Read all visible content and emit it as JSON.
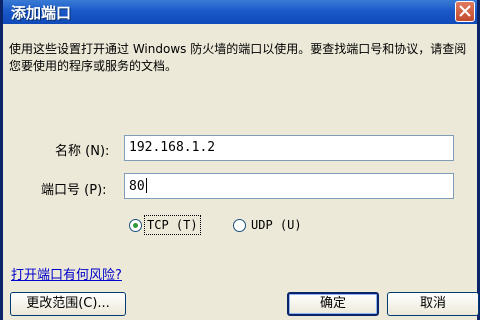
{
  "window": {
    "title": "添加端口"
  },
  "description": "使用这些设置打开通过 Windows 防火墙的端口以使用。要查找端口号和协议，请查阅您要使用的程序或服务的文档。",
  "name_field": {
    "label": "名称",
    "hotkey": "(N)",
    "suffix": ":",
    "value": "192.168.1.2"
  },
  "port_field": {
    "label": "端口号",
    "hotkey": "(P)",
    "suffix": ":",
    "value": "80"
  },
  "protocol": {
    "tcp": {
      "label": "TCP",
      "hotkey": "(T)",
      "selected": true
    },
    "udp": {
      "label": "UDP",
      "hotkey": "(U)",
      "selected": false
    }
  },
  "risk_link": "打开端口有何风险?",
  "buttons": {
    "change_scope": "更改范围(C)...",
    "ok": "确定",
    "cancel": "取消"
  }
}
